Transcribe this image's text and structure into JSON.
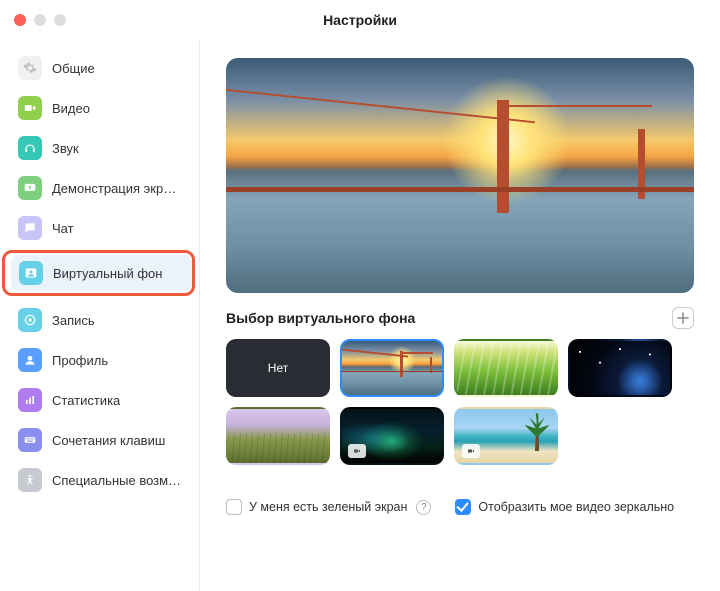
{
  "window": {
    "title": "Настройки"
  },
  "sidebar": {
    "items": [
      {
        "label": "Общие",
        "icon": "gear-icon",
        "color": "bg-gray"
      },
      {
        "label": "Видео",
        "icon": "video-icon",
        "color": "bg-green"
      },
      {
        "label": "Звук",
        "icon": "headphones-icon",
        "color": "bg-teal"
      },
      {
        "label": "Демонстрация экр…",
        "icon": "share-screen-icon",
        "color": "bg-green2"
      },
      {
        "label": "Чат",
        "icon": "chat-icon",
        "color": "bg-lav"
      },
      {
        "label": "Виртуальный фон",
        "icon": "virtual-bg-icon",
        "color": "bg-cyan",
        "active": true,
        "highlighted": true
      },
      {
        "label": "Запись",
        "icon": "record-icon",
        "color": "bg-cyan"
      },
      {
        "label": "Профиль",
        "icon": "profile-icon",
        "color": "bg-blue"
      },
      {
        "label": "Статистика",
        "icon": "stats-icon",
        "color": "bg-purple"
      },
      {
        "label": "Сочетания клавиш",
        "icon": "keyboard-icon",
        "color": "bg-indigo"
      },
      {
        "label": "Специальные возм…",
        "icon": "accessibility-icon",
        "color": "bg-gray2"
      }
    ]
  },
  "virtual_bg": {
    "section_title": "Выбор виртуального фона",
    "none_label": "Нет",
    "thumbs": [
      {
        "kind": "none"
      },
      {
        "kind": "image",
        "scene": "scene-bridge",
        "selected": true
      },
      {
        "kind": "image",
        "scene": "scene-grass"
      },
      {
        "kind": "image",
        "scene": "scene-earth"
      },
      {
        "kind": "image",
        "scene": "scene-field"
      },
      {
        "kind": "video",
        "scene": "scene-aurora"
      },
      {
        "kind": "video",
        "scene": "scene-beach"
      }
    ]
  },
  "options": {
    "green_screen": {
      "label": "У меня есть зеленый экран",
      "checked": false
    },
    "mirror": {
      "label": "Отобразить мое видео зеркально",
      "checked": true
    }
  }
}
